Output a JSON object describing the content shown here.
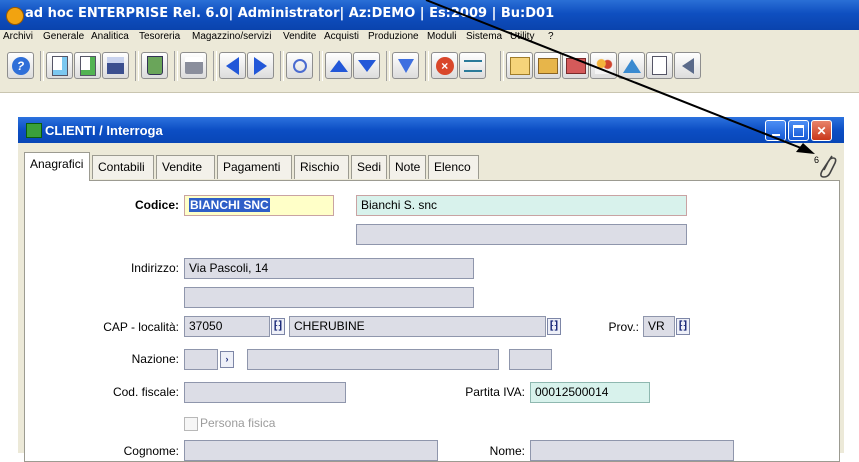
{
  "app": {
    "title": "ad hoc ENTERPRISE Rel. 6.0| Administrator| Az:DEMO | Es:2009 | Bu:D01"
  },
  "menu": [
    "Archivi",
    "Generale",
    "Analitica",
    "Tesoreria",
    "Magazzino/servizi",
    "Vendite",
    "Acquisti",
    "Produzione",
    "Moduli",
    "Sistema",
    "Utility",
    "?"
  ],
  "window": {
    "title": "CLIENTI / Interroga",
    "attachment_count": "6"
  },
  "tabs": [
    "Anagrafici",
    "Contabili",
    "Vendite",
    "Pagamenti",
    "Rischio",
    "Sedi",
    "Note",
    "Elenco"
  ],
  "form": {
    "codice_label": "Codice:",
    "codice": "BIANCHI SNC",
    "ragione_sociale": "Bianchi S. snc",
    "indirizzo_label": "Indirizzo:",
    "indirizzo": "Via Pascoli, 14",
    "cap_label": "CAP - località:",
    "cap": "37050",
    "localita": "CHERUBINE",
    "prov_label": "Prov.:",
    "prov": "VR",
    "nazione_label": "Nazione:",
    "cod_fiscale_label": "Cod. fiscale:",
    "partita_iva_label": "Partita IVA:",
    "partita_iva": "00012500014",
    "persona_fisica_label": "Persona fisica",
    "cognome_label": "Cognome:",
    "nome_label": "Nome:"
  },
  "colors": {
    "title_blue": "#0f4fc0",
    "code_field_bg": "#ffffc8",
    "name_field_bg": "#d8f2ec",
    "piva_bg": "#d8f2ec",
    "close_red": "#d9472a"
  }
}
